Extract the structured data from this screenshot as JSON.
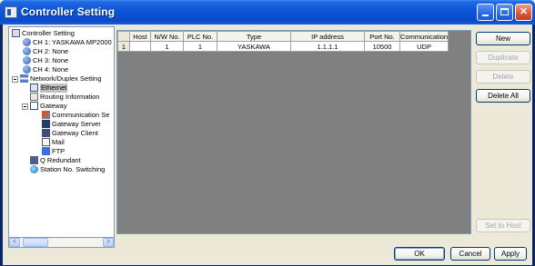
{
  "window": {
    "title": "Controller Setting"
  },
  "tree": {
    "items": [
      {
        "label": "Controller Setting",
        "icon": "controller-icon"
      },
      {
        "label": "CH 1: YASKAWA MP2000",
        "icon": "channel-icon"
      },
      {
        "label": "CH 2: None",
        "icon": "channel-icon"
      },
      {
        "label": "CH 3: None",
        "icon": "channel-icon"
      },
      {
        "label": "CH 4: None",
        "icon": "channel-icon"
      },
      {
        "label": "Network/Duplex Setting",
        "icon": "network-icon"
      },
      {
        "label": "Ethernet",
        "icon": "ethernet-icon",
        "selected": true
      },
      {
        "label": "Routing Information",
        "icon": "routing-icon"
      },
      {
        "label": "Gateway",
        "icon": "gateway-icon"
      },
      {
        "label": "Communication Se",
        "icon": "communication-icon"
      },
      {
        "label": "Gateway Server",
        "icon": "gateway-server-icon"
      },
      {
        "label": "Gateway Client",
        "icon": "gateway-client-icon"
      },
      {
        "label": "Mail",
        "icon": "mail-icon"
      },
      {
        "label": "FTP",
        "icon": "ftp-icon"
      },
      {
        "label": "Q Redundant",
        "icon": "q-redundant-icon"
      },
      {
        "label": "Station No. Switching",
        "icon": "station-icon"
      }
    ],
    "scroll_left": "<",
    "scroll_right": ">"
  },
  "table": {
    "columns": [
      "",
      "Host",
      "N/W No.",
      "PLC No.",
      "Type",
      "IP address",
      "Port No.",
      "Communication"
    ],
    "rows": [
      [
        "1",
        "",
        "1",
        "1",
        "YASKAWA",
        "1.1.1.1",
        "10500",
        "UDP"
      ]
    ]
  },
  "side_buttons": {
    "new": "New",
    "duplicate": "Duplicate",
    "delete": "Delete",
    "delete_all": "Delete All",
    "set_to_host": "Set to Host"
  },
  "bottom_buttons": {
    "ok": "OK",
    "cancel": "Cancel",
    "apply": "Apply"
  }
}
